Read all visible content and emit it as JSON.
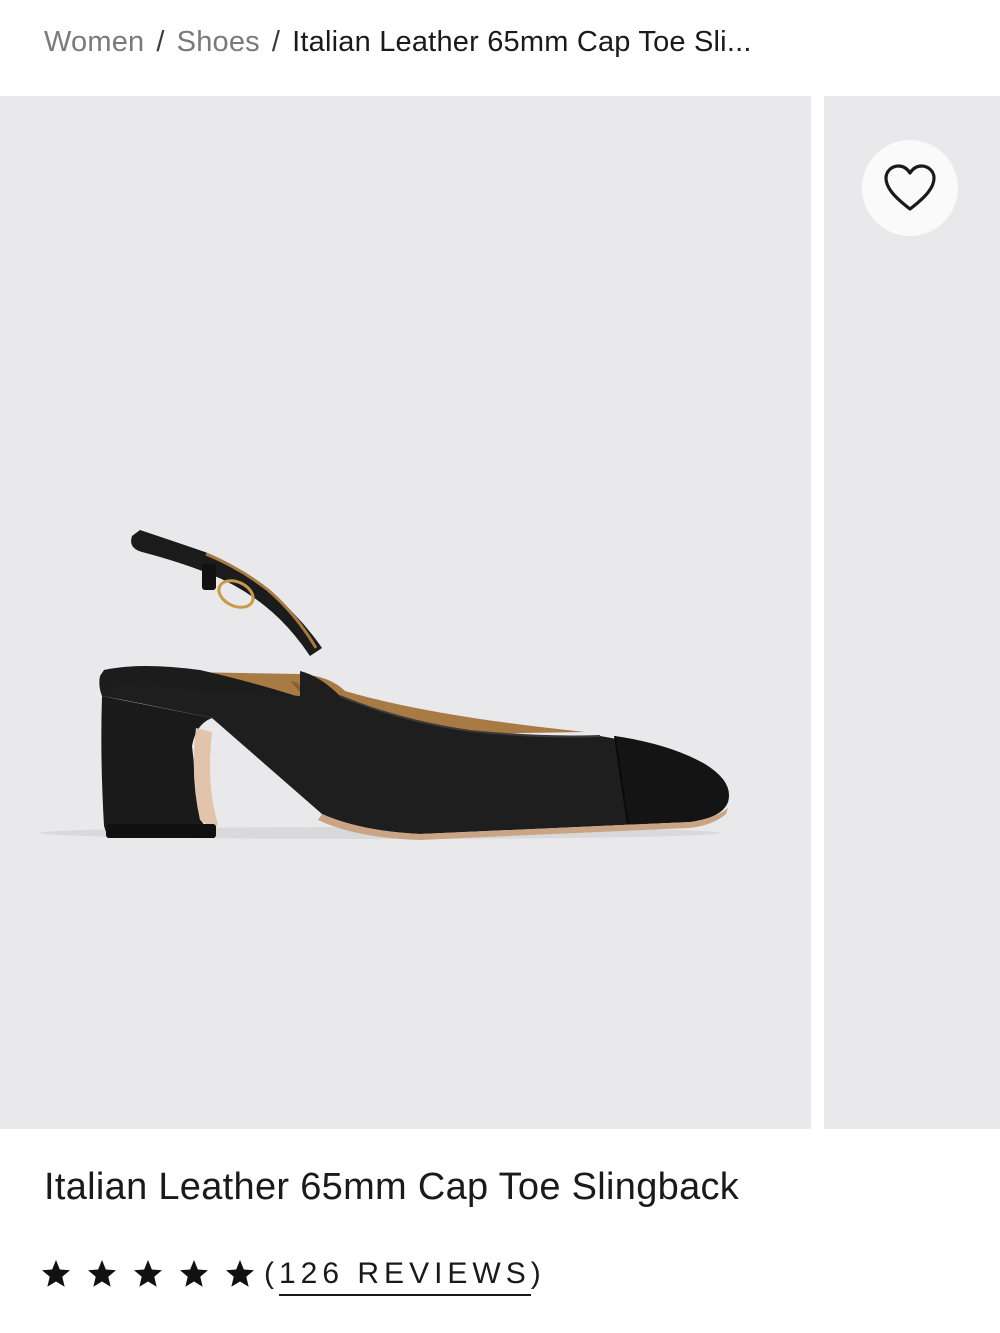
{
  "breadcrumb": {
    "items": [
      {
        "label": "Women"
      },
      {
        "label": "Shoes"
      }
    ],
    "separator": "/",
    "current": "Italian Leather 65mm Cap Toe Sli..."
  },
  "gallery": {
    "main_image_alt": "",
    "wishlist_icon": "heart-outline-icon"
  },
  "product": {
    "title": "Italian Leather 65mm Cap Toe Slingback",
    "rating": {
      "stars": 5,
      "reviews_open": "(",
      "reviews_text": "126 REVIEWS",
      "reviews_close": ")"
    }
  },
  "colors": {
    "background": "#ffffff",
    "image_background": "#e9e9eb",
    "text": "#1a1a1a",
    "muted_text": "#7a7a7a"
  }
}
